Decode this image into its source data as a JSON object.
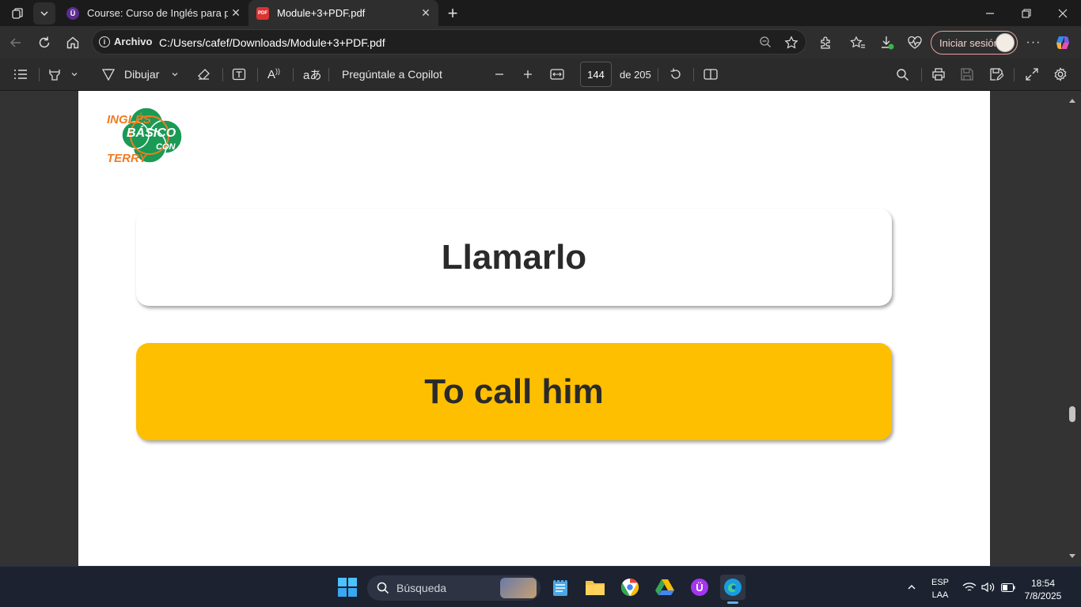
{
  "browser": {
    "tabs": [
      {
        "label": "Course: Curso de Inglés para principiantes",
        "active": false
      },
      {
        "label": "Module+3+PDF.pdf",
        "active": true
      }
    ],
    "address": {
      "prefix": "Archivo",
      "url": "C:/Users/cafef/Downloads/Module+3+PDF.pdf"
    },
    "signin_label": "Iniciar sesión"
  },
  "pdf_toolbar": {
    "draw_label": "Dibujar",
    "copilot_label": "Pregúntale a Copilot",
    "page_current": "144",
    "page_total_label": "de 205"
  },
  "document": {
    "logo": {
      "line1": "INGLÉS",
      "line2": "BÁSICO",
      "line3": "CON",
      "line4": "TERRY"
    },
    "card_spanish": "Llamarlo",
    "card_english": "To call him"
  },
  "taskbar": {
    "search_placeholder": "Búsqueda",
    "lang_top": "ESP",
    "lang_bottom": "LAA",
    "time": "18:54",
    "date": "7/8/2025"
  },
  "colors": {
    "card_highlight": "#fdbf00",
    "logo_green": "#1a9a55",
    "logo_orange": "#f07b22"
  }
}
